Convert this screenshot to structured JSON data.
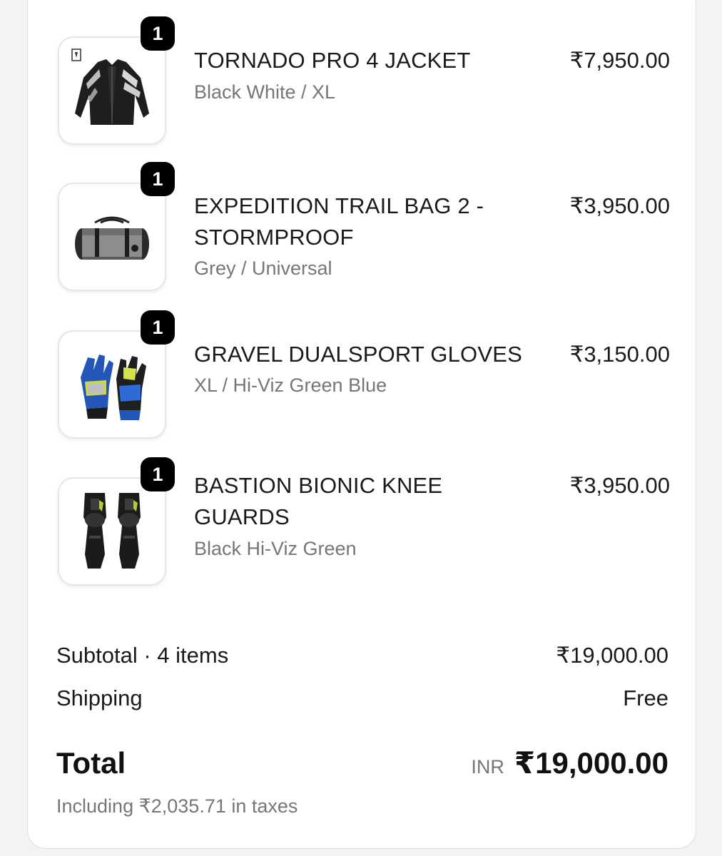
{
  "items": [
    {
      "name_line1": "TORNADO PRO 4 JACKET",
      "name_line2": "",
      "variant": "Black White / XL",
      "price": "₹7,950.00",
      "quantity": "1",
      "image_icon": "jacket-icon"
    },
    {
      "name_line1": "EXPEDITION TRAIL BAG 2 -",
      "name_line2": "STORMPROOF",
      "variant": "Grey / Universal",
      "price": "₹3,950.00",
      "quantity": "1",
      "image_icon": "duffel-bag-icon"
    },
    {
      "name_line1": "GRAVEL DUALSPORT GLOVES",
      "name_line2": "",
      "variant": "XL / Hi-Viz Green Blue",
      "price": "₹3,150.00",
      "quantity": "1",
      "image_icon": "gloves-icon"
    },
    {
      "name_line1": "BASTION BIONIC KNEE",
      "name_line2": "GUARDS",
      "variant": "Black Hi-Viz Green",
      "price": "₹3,950.00",
      "quantity": "1",
      "image_icon": "knee-guards-icon"
    }
  ],
  "summary": {
    "subtotal_label": "Subtotal · 4 items",
    "subtotal_value": "₹19,000.00",
    "shipping_label": "Shipping",
    "shipping_value": "Free",
    "total_label": "Total",
    "currency": "INR",
    "total_value": "₹19,000.00",
    "tax_note": "Including ₹2,035.71 in taxes"
  },
  "colors": {
    "badge_bg": "#000000",
    "muted_text": "#767676",
    "primary_text": "#1a1a1a"
  }
}
